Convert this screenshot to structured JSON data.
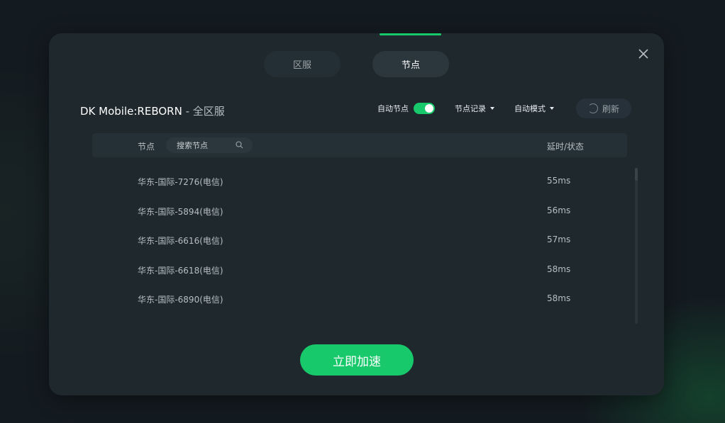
{
  "tabs": [
    {
      "label": "区服",
      "active": false
    },
    {
      "label": "节点",
      "active": true
    }
  ],
  "game": {
    "title": "DK Mobile:REBORN",
    "separator": " - ",
    "server": "全区服"
  },
  "controls": {
    "auto_node_label": "自动节点",
    "auto_node_on": true,
    "node_history_label": "节点记录",
    "auto_mode_label": "自动模式",
    "refresh_label": "刷新"
  },
  "table": {
    "header_node": "节点",
    "search_placeholder": "搜索节点",
    "header_latency": "延时/状态",
    "rows": [
      {
        "name": "华东-国际-7276(电信)",
        "latency": "55ms"
      },
      {
        "name": "华东-国际-5894(电信)",
        "latency": "56ms"
      },
      {
        "name": "华东-国际-6616(电信)",
        "latency": "57ms"
      },
      {
        "name": "华东-国际-6618(电信)",
        "latency": "58ms"
      },
      {
        "name": "华东-国际-6890(电信)",
        "latency": "58ms"
      }
    ]
  },
  "accelerate_label": "立即加速",
  "colors": {
    "accent": "#18c96b",
    "dialog_bg": "#1e282d",
    "page_bg": "#141b20"
  },
  "icons": {
    "close": "close-icon",
    "search": "search-icon",
    "refresh": "refresh-spinner-icon",
    "dropdown": "caret-down-icon"
  }
}
